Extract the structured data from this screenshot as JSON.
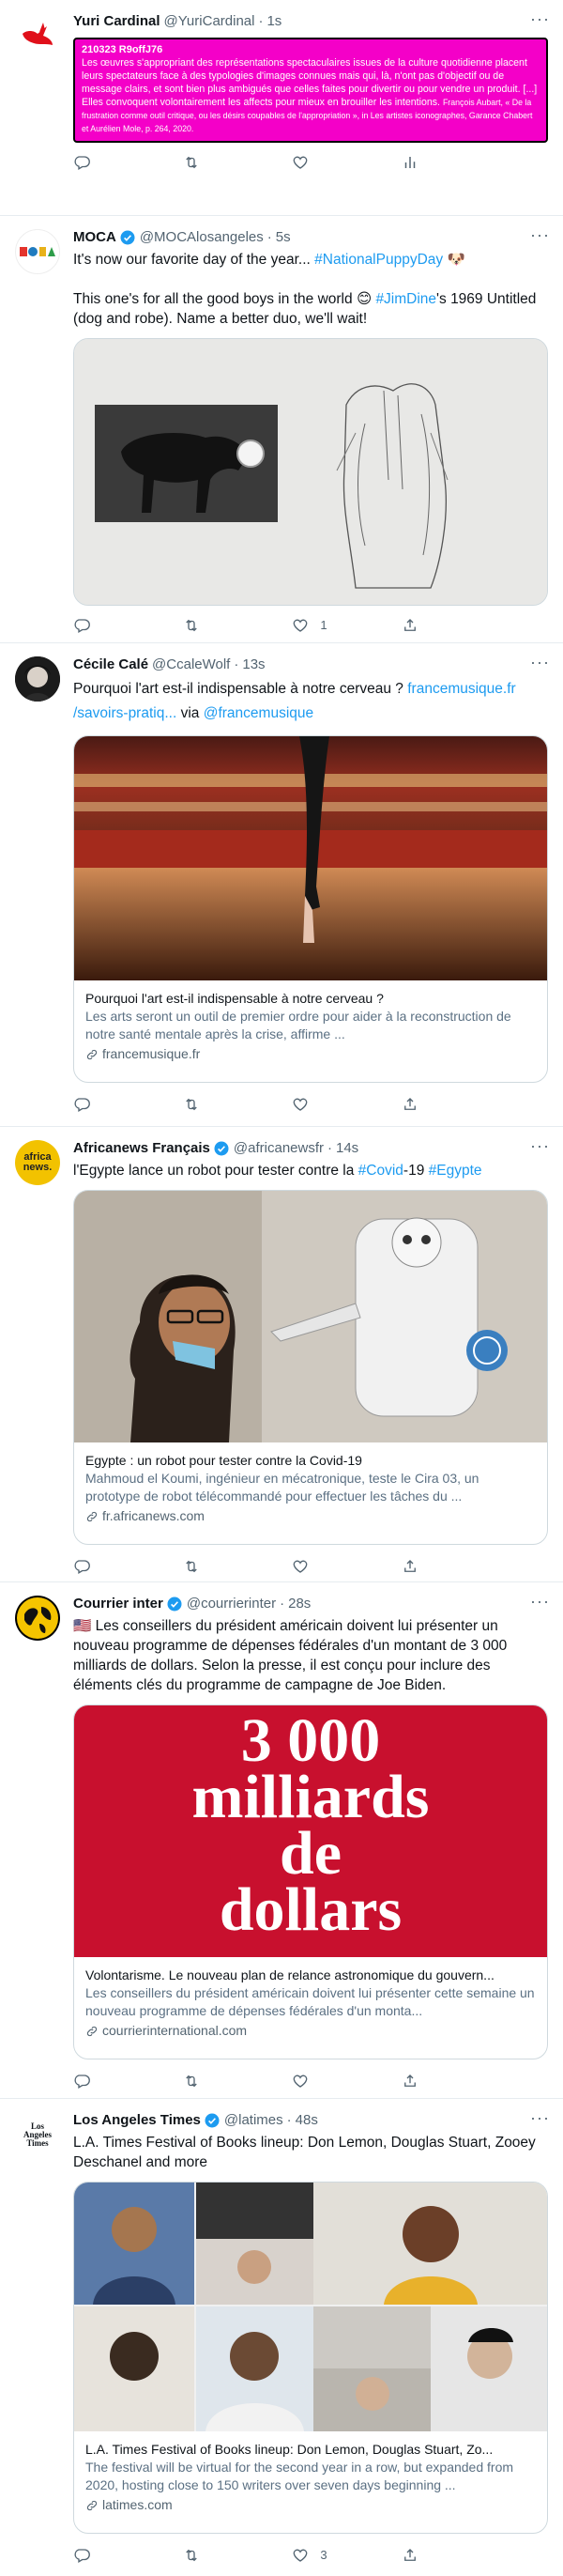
{
  "colors": {
    "accent": "#1d9bf0",
    "pink": "#f400c8",
    "muted": "#536471"
  },
  "tweets": [
    {
      "name": "Yuri Cardinal",
      "handle": "@YuriCardinal",
      "time": "1s",
      "pink_code": "210323 R9offJ76",
      "pink_body": "Les œuvres s'appropriant des représentations spectaculaires issues de la culture quotidienne placent leurs spectateurs face à des typologies d'images connues mais qui, là, n'ont pas d'objectif ou de message clairs, et sont bien plus ambigués que celles faites pour divertir ou pour vendre un produit. [...] Elles convoquent volontairement les affects pour mieux en brouiller les intentions.",
      "pink_cite": "François Aubart, « De la frustration comme outil critique, ou les désirs coupables de l'appropriation », in Les artistes iconographes, Garance Chabert et Aurélien Mole, p. 264, 2020."
    },
    {
      "name": "MOCA",
      "handle": "@MOCAlosangeles",
      "time": "5s",
      "line1": "It's now our favorite day of the year...",
      "hashtag1": "#NationalPuppyDay",
      "line2a": "This one's for all the good boys in the world",
      "hashtag2": "#JimDine",
      "line2b": "'s 1969 Untitled (dog and robe). Name a better duo, we'll wait!",
      "likes": "1"
    },
    {
      "name": "Cécile Calé",
      "handle": "@CcaleWolf",
      "time": "13s",
      "text": "Pourquoi l'art est-il indispensable à notre cerveau ?",
      "link": "francemusique.fr /savoirs-pratiq...",
      "via": "via",
      "mention": "@francemusique",
      "card_title": "Pourquoi l'art est-il indispensable à notre cerveau ?",
      "card_desc": "Les arts seront un outil de premier ordre pour aider à la reconstruction de notre santé mentale après la crise, affirme ...",
      "card_domain": "francemusique.fr"
    },
    {
      "name": "Africanews Français",
      "handle": "@africanewsfr",
      "time": "14s",
      "text": "l'Egypte lance un robot pour tester contre la",
      "hashtag1": "#Covid",
      "text2": "-19",
      "hashtag2": "#Egypte",
      "card_title": "Egypte : un robot pour tester contre la Covid-19",
      "card_desc": "Mahmoud el Koumi, ingénieur en mécatronique, teste le Cira 03, un prototype de robot télécommandé pour effectuer les tâches du ...",
      "card_domain": "fr.africanews.com",
      "avatar_text": "africa news."
    },
    {
      "name": "Courrier inter",
      "handle": "@courrierinter",
      "time": "28s",
      "text": "Les conseillers du président américain doivent lui présenter un nouveau programme de dépenses fédérales d'un montant de 3 000 milliards de dollars. Selon la presse, il est conçu pour inclure des éléments clés du programme de campagne de Joe Biden.",
      "image_text": [
        "3 000",
        "milliards",
        "de",
        "dollars"
      ],
      "card_title": "Volontarisme. Le nouveau plan de relance astronomique du gouvern...",
      "card_desc": "Les conseillers du président américain doivent lui présenter cette semaine un nouveau programme de dépenses fédérales d'un monta...",
      "card_domain": "courrierinternational.com"
    },
    {
      "name": "Los Angeles Times",
      "handle": "@latimes",
      "time": "48s",
      "text": "L.A. Times Festival of Books lineup: Don Lemon, Douglas Stuart, Zooey Deschanel and more",
      "card_title": "L.A. Times Festival of Books lineup: Don Lemon, Douglas Stuart, Zo...",
      "card_desc": "The festival will be virtual for the second year in a row, but expanded from 2020, hosting close to 150 writers over seven days beginning ...",
      "card_domain": "latimes.com",
      "likes": "3",
      "avatar_text": "Los Angeles Times"
    }
  ],
  "icons": [
    "reply-icon",
    "retweet-icon",
    "like-icon",
    "share-icon",
    "analytics-icon",
    "verified-icon",
    "more-icon",
    "link-icon"
  ]
}
